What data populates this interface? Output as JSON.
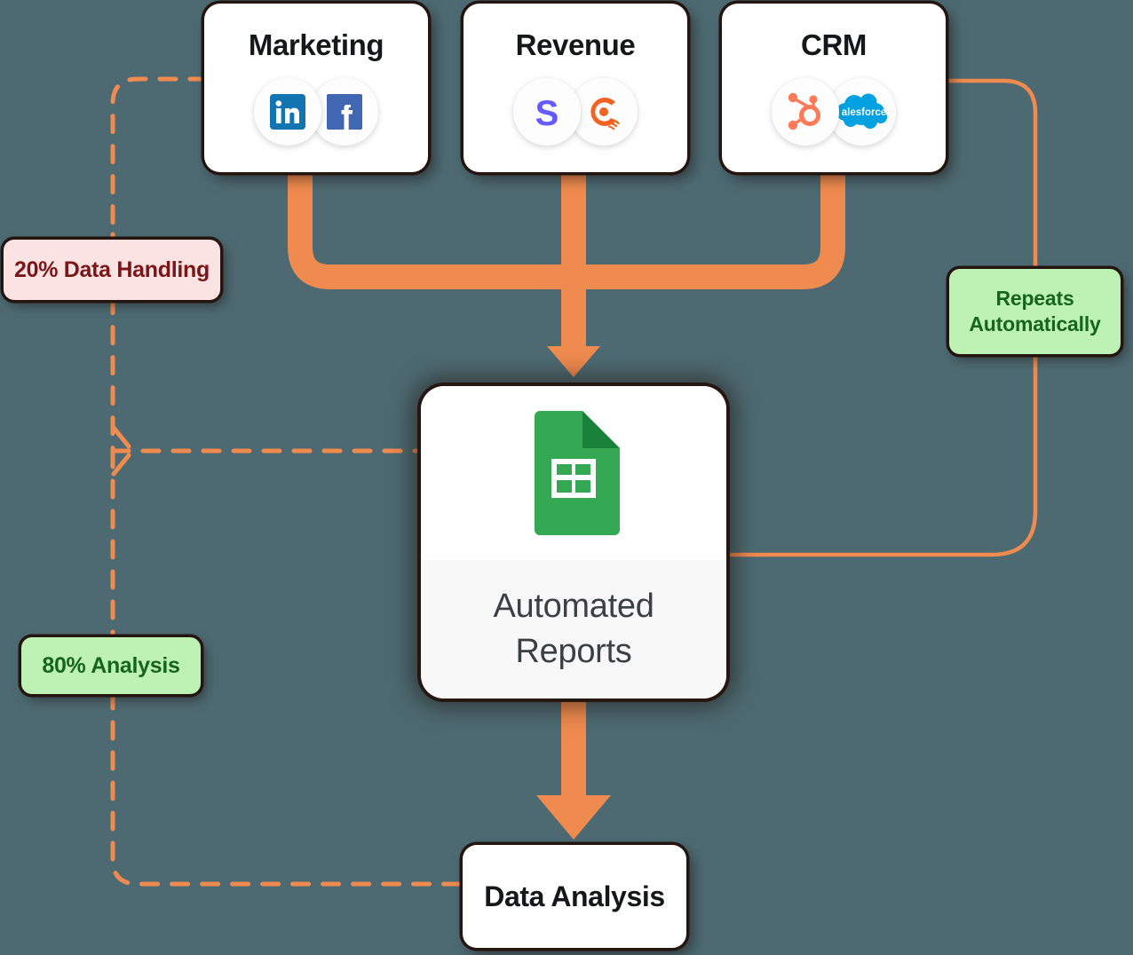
{
  "diagram": {
    "type": "flow",
    "background_color": "#4d6a72",
    "accent_color": "#ef8b4f",
    "sources": [
      {
        "title": "Marketing",
        "logos": [
          {
            "name": "linkedin-icon",
            "color": "#1275b1"
          },
          {
            "name": "facebook-icon",
            "color": "#4267b2"
          }
        ]
      },
      {
        "title": "Revenue",
        "logos": [
          {
            "name": "stripe-icon",
            "color": "#635bff"
          },
          {
            "name": "chartmogul-icon",
            "color": "#f26322"
          }
        ]
      },
      {
        "title": "CRM",
        "logos": [
          {
            "name": "hubspot-icon",
            "color": "#ff7a59"
          },
          {
            "name": "salesforce-icon",
            "color": "#00a1e0",
            "wordmark": "alesforce"
          }
        ]
      }
    ],
    "center": {
      "icon": "google-sheets-icon",
      "icon_color": "#34a853",
      "label": "Automated\nReports"
    },
    "output": {
      "label": "Data Analysis"
    },
    "annotations": [
      {
        "id": "data-handling",
        "text": "20% Data Handling",
        "background_color": "#fbe3e3",
        "text_color": "#7a1518"
      },
      {
        "id": "analysis",
        "text": "80% Analysis",
        "background_color": "#bdf2b4",
        "text_color": "#15661c"
      },
      {
        "id": "repeats",
        "text": "Repeats\nAutomatically",
        "background_color": "#bdf2b4",
        "text_color": "#15661c"
      }
    ],
    "connectors": [
      {
        "name": "marketing-to-center",
        "style": "thick-pipe",
        "color": "#ef8b4f"
      },
      {
        "name": "revenue-to-center",
        "style": "thick-pipe",
        "color": "#ef8b4f"
      },
      {
        "name": "crm-to-center",
        "style": "thick-pipe",
        "color": "#ef8b4f"
      },
      {
        "name": "center-to-data-analysis",
        "style": "thick-pipe-arrow",
        "color": "#ef8b4f"
      },
      {
        "name": "crm-repeat-loop-to-center",
        "style": "thin-solid",
        "color": "#ef8b4f"
      },
      {
        "name": "marketing-dashed-to-center",
        "style": "thin-dashed",
        "color": "#ef8b4f"
      },
      {
        "name": "dashed-to-data-analysis",
        "style": "thin-dashed",
        "color": "#ef8b4f"
      }
    ]
  }
}
